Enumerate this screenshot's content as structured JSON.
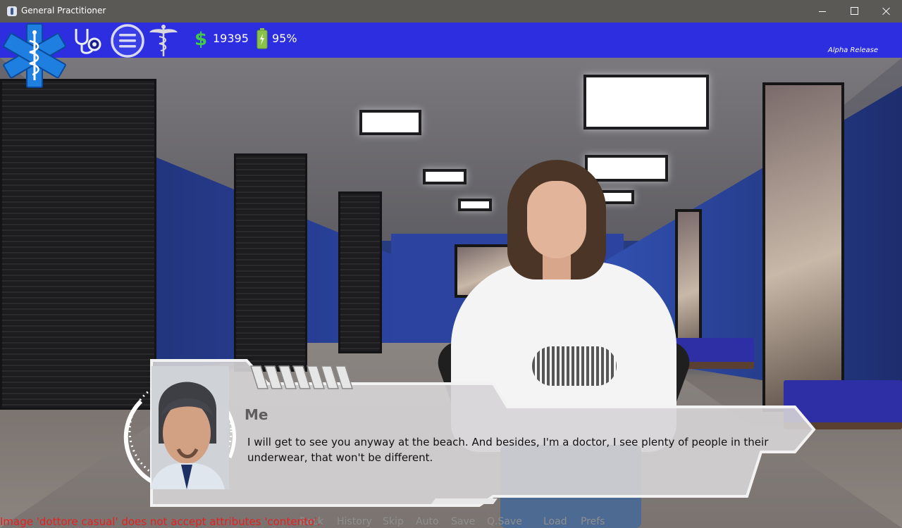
{
  "window": {
    "title": "General Practitioner"
  },
  "hud": {
    "money": "19395",
    "battery": "95%",
    "release_label": "Alpha Release"
  },
  "dialogue": {
    "speaker": "Me",
    "text": "I will get to see you anyway at the beach. And besides, I'm a doctor, I see plenty of people in their underwear, that won't be different."
  },
  "quick_menu": {
    "back": "Back",
    "history": "History",
    "skip": "Skip",
    "auto": "Auto",
    "save": "Save",
    "qsave": "Q.Save",
    "load": "Load",
    "prefs": "Prefs"
  },
  "error_text": "Image 'dottore casual' does not accept attributes 'contento'.",
  "colors": {
    "hud_bar": "#2c2ee0",
    "money_icon": "#41c94a",
    "error": "#e81f1f",
    "emblem": "#1f7fe0"
  }
}
